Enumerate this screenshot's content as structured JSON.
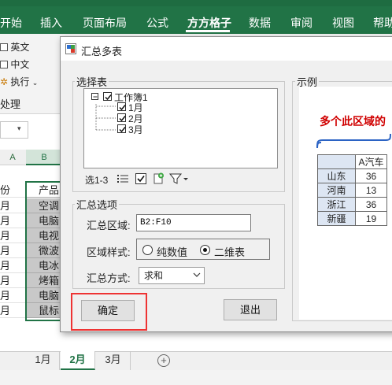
{
  "ribbon": {
    "tabs": [
      "开始",
      "插入",
      "页面布局",
      "公式",
      "方方格子",
      "数据",
      "审阅",
      "视图",
      "帮助"
    ],
    "active_tab": "方方格子",
    "items": [
      "英文",
      "中文",
      "执行",
      "处理"
    ]
  },
  "sheet": {
    "column_a_header": "A",
    "column_b_header": "B",
    "col_a_cells": [
      "份",
      "月",
      "月",
      "月",
      "月",
      "月",
      "月",
      "月",
      "月"
    ],
    "col_b_cells": [
      "产品",
      "空调",
      "电脑",
      "电视",
      "微波",
      "电冰",
      "烤箱",
      "电脑",
      "鼠标"
    ],
    "tabs": [
      "1月",
      "2月",
      "3月"
    ],
    "active_tab": "2月",
    "add_sheet": "+"
  },
  "dialog": {
    "title": "汇总多表",
    "select_table_label": "选择表",
    "tree": {
      "root": "工作簿1",
      "children": [
        "1月",
        "2月",
        "3月"
      ]
    },
    "selected_count": "选1-3",
    "options_label": "汇总选项",
    "range_label": "汇总区域:",
    "range_value": "B2:F10",
    "style_label": "区域样式:",
    "style_options": [
      "纯数值",
      "二维表"
    ],
    "style_selected": "二维表",
    "method_label": "汇总方式:",
    "method_value": "求和",
    "ok_button": "确定",
    "exit_button": "退出",
    "preview_label": "示例",
    "preview_caption": "多个此区域的",
    "preview_table": {
      "header": [
        "A汽车"
      ],
      "rows": [
        {
          "label": "山东",
          "value": "36"
        },
        {
          "label": "河南",
          "value": "13"
        },
        {
          "label": "浙江",
          "value": "36"
        },
        {
          "label": "新疆",
          "value": "19"
        }
      ]
    }
  },
  "colors": {
    "excel_green": "#217346",
    "highlight_red": "#e33333",
    "caption_red": "#d00000"
  }
}
